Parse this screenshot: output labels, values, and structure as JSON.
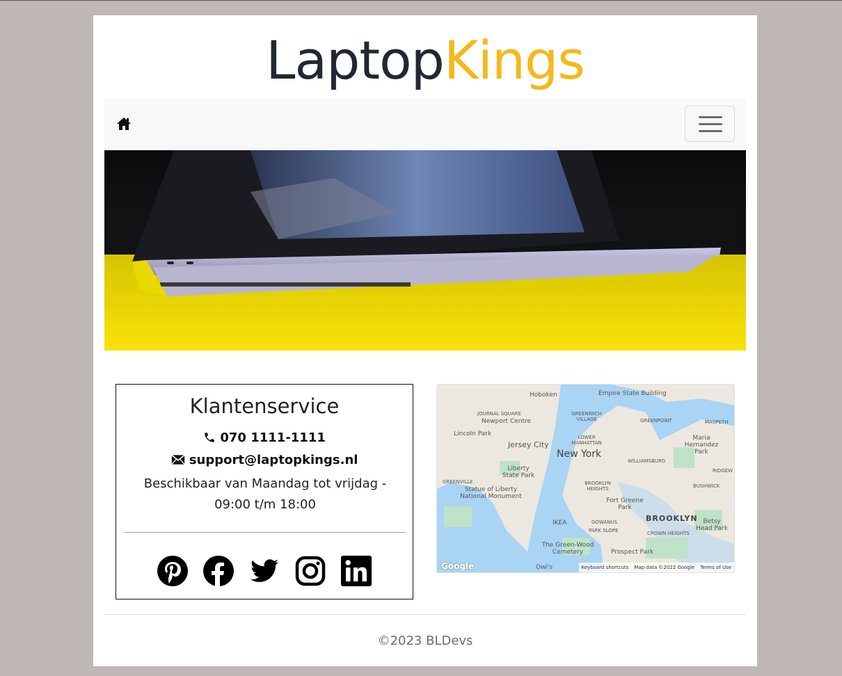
{
  "logo": {
    "part1": "Laptop",
    "part2": "Kings"
  },
  "nav": {
    "home_icon": "home-icon",
    "toggler_icon": "hamburger-icon"
  },
  "hero": {
    "alt_icon": "laptop-photo"
  },
  "service": {
    "title": "Klantenservice",
    "phone": "070 1111-1111",
    "email": "support@laptopkings.nl",
    "hours_line1": "Beschikbaar van Maandag tot vrijdag -",
    "hours_line2": "09:00 t/m 18:00",
    "socials": [
      "pinterest-icon",
      "facebook-icon",
      "twitter-icon",
      "instagram-icon",
      "linkedin-icon"
    ]
  },
  "map": {
    "labels": {
      "hoboken": "Hoboken",
      "empire": "Empire State Building",
      "journal": "JOURNAL SQUARE",
      "newport": "Newport Centre",
      "greenwich": "GREENWICH VILLAGE",
      "greenpoint": "GREENPOINT",
      "maspeth": "MASPETH",
      "lincoln": "Lincoln Park",
      "jersey": "Jersey City",
      "lower": "LOWER MANHATTAN",
      "maria": "Maria Hernandez Park",
      "newyork": "New York",
      "williamsburg": "WILLIAMSBURG",
      "ridgewood": "RIDGEW",
      "liberty_park": "Liberty State Park",
      "greenville": "GREENVILLE",
      "statue": "Statue of Liberty National Monument",
      "brooklyn_heights": "BROOKLYN HEIGHTS",
      "bushwick": "BUSHWICK",
      "fort_greene": "Fort Greene Park",
      "brooklyn": "BROOKLYN",
      "ikea": "IKEA",
      "gowanus": "GOWANUS",
      "betsy": "Betsy Head Park",
      "park_slope": "PARK SLOPE",
      "crown": "CROWN HEIGHTS",
      "greenwood": "The Green-Wood Cemetery",
      "prospect": "Prospect Park",
      "owls": "Owl's",
      "google": "Google",
      "shortcuts": "Keyboard shortcuts",
      "mapdata": "Map data ©2022 Google",
      "terms": "Terms of Use"
    }
  },
  "footer": {
    "text": "©2023 BLDevs"
  }
}
